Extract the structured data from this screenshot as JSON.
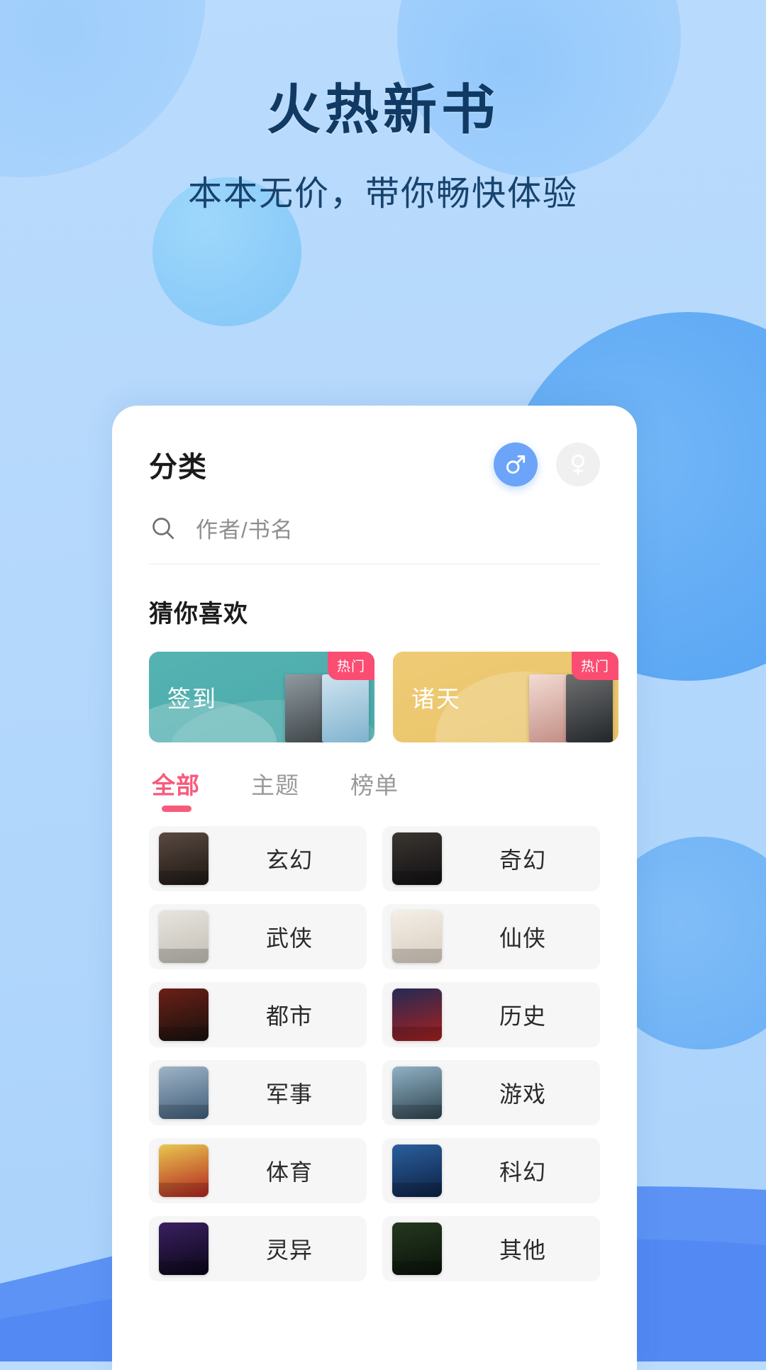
{
  "hero": {
    "title": "火热新书",
    "subtitle": "本本无价，带你畅快体验",
    "title_color": "#103a63",
    "subtitle_color": "#17436d"
  },
  "card": {
    "header": {
      "title": "分类",
      "gender": {
        "male": {
          "icon": "male-symbol-icon",
          "label": "♂",
          "active": true,
          "color": "#6ba4f8"
        },
        "female": {
          "icon": "female-symbol-icon",
          "label": "♀",
          "active": false,
          "color": "#f0f0f0"
        }
      }
    },
    "search": {
      "icon": "search-icon",
      "placeholder": "作者/书名",
      "value": ""
    },
    "guess": {
      "title": "猜你喜欢",
      "promos": [
        {
          "label": "签到",
          "badge": "热门",
          "theme": "teal",
          "badge_color": "#fb4c72",
          "bg_color": "#4fabab"
        },
        {
          "label": "诸天",
          "badge": "热门",
          "theme": "gold",
          "badge_color": "#fb4c72",
          "bg_color": "#ebc66e"
        }
      ]
    },
    "tabs": [
      {
        "label": "全部",
        "active": true
      },
      {
        "label": "主题",
        "active": false
      },
      {
        "label": "榜单",
        "active": false
      }
    ],
    "tab_active_color": "#f85a7c",
    "categories": [
      {
        "label": "玄幻",
        "thumb": "book-cover-wangu-shenjue",
        "c1": "#5a4a41",
        "c2": "#1d1713"
      },
      {
        "label": "奇幻",
        "thumb": "book-cover-qihuan-yusheng",
        "c1": "#3a3631",
        "c2": "#111012"
      },
      {
        "label": "武侠",
        "thumb": "book-cover-wanshenji",
        "c1": "#e7e4de",
        "c2": "#c3bfb6"
      },
      {
        "label": "仙侠",
        "thumb": "book-cover-xianxia",
        "c1": "#f5efe6",
        "c2": "#d8cdc0"
      },
      {
        "label": "都市",
        "thumb": "book-cover-dushi",
        "c1": "#6b1f16",
        "c2": "#17110e"
      },
      {
        "label": "历史",
        "thumb": "book-cover-lishi",
        "c1": "#242a55",
        "c2": "#a8201d"
      },
      {
        "label": "军事",
        "thumb": "book-cover-junshi",
        "c1": "#9fb4c6",
        "c2": "#3f5d79"
      },
      {
        "label": "游戏",
        "thumb": "book-cover-youxi",
        "c1": "#8fb2c4",
        "c2": "#2f4350"
      },
      {
        "label": "体育",
        "thumb": "book-cover-1958",
        "c1": "#e8c74e",
        "c2": "#b32320"
      },
      {
        "label": "科幻",
        "thumb": "book-cover-kehuan",
        "c1": "#2b5f9e",
        "c2": "#0d2144"
      },
      {
        "label": "灵异",
        "thumb": "book-cover-lingyi",
        "c1": "#3a2060",
        "c2": "#0a0618"
      },
      {
        "label": "其他",
        "thumb": "book-cover-qita",
        "c1": "#24381f",
        "c2": "#0b120a"
      }
    ]
  }
}
